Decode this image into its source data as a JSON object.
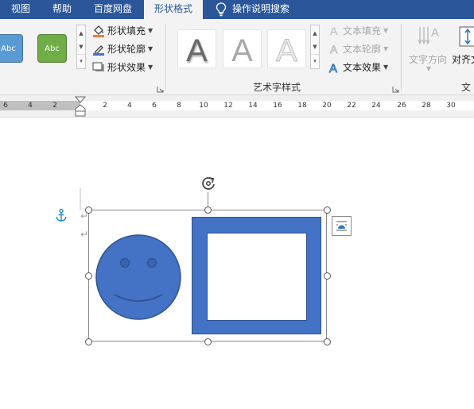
{
  "tabs": [
    {
      "label": "视图",
      "active": false
    },
    {
      "label": "帮助",
      "active": false
    },
    {
      "label": "百度网盘",
      "active": false
    },
    {
      "label": "形状格式",
      "active": true
    },
    {
      "label": "操作说明搜索",
      "active": false
    }
  ],
  "shape_styles": {
    "items": [
      {
        "label": "Abc",
        "color": "#5b9bd5"
      },
      {
        "label": "Abc",
        "color": "#70ad47"
      }
    ],
    "commands": [
      {
        "label": "形状填充",
        "icon": "paint-bucket-icon"
      },
      {
        "label": "形状轮廓",
        "icon": "pen-outline-icon"
      },
      {
        "label": "形状效果",
        "icon": "shape-effect-icon"
      }
    ]
  },
  "wordart": {
    "group_label": "艺术字样式",
    "letter": "A",
    "commands": [
      {
        "label": "文本填充",
        "icon": "text-fill-icon",
        "enabled": false
      },
      {
        "label": "文本轮廓",
        "icon": "text-outline-icon",
        "enabled": false
      },
      {
        "label": "文本效果",
        "icon": "text-effect-icon",
        "enabled": true
      }
    ]
  },
  "text_group": {
    "direction_label": "文字方向",
    "align_label": "对齐文",
    "group_label": "文本"
  },
  "ruler": {
    "left_numbers": [
      "6",
      "4",
      "2"
    ],
    "right_numbers": [
      "2",
      "4",
      "6",
      "8",
      "10",
      "12",
      "14",
      "16",
      "18",
      "20",
      "22",
      "24",
      "26",
      "28",
      "30"
    ]
  },
  "colors": {
    "tab_bar": "#2b579a",
    "shape_fill": "#4472c4",
    "shape_outline": "#2f528f",
    "anchor": "#1e88c8"
  }
}
